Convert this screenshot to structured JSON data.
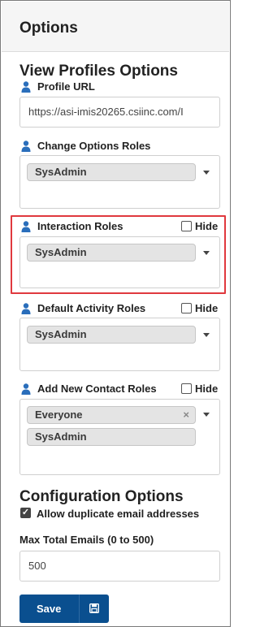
{
  "panel": {
    "title": "Options"
  },
  "view_profiles": {
    "title": "View Profiles Options",
    "profile_url": {
      "label": "Profile URL",
      "value": "https://asi-imis20265.csiinc.com/I"
    },
    "change_options_roles": {
      "label": "Change Options Roles",
      "tags": [
        "SysAdmin"
      ]
    },
    "interaction_roles": {
      "label": "Interaction Roles",
      "hide_label": "Hide",
      "hide_checked": false,
      "tags": [
        "SysAdmin"
      ]
    },
    "default_activity_roles": {
      "label": "Default Activity Roles",
      "hide_label": "Hide",
      "hide_checked": false,
      "tags": [
        "SysAdmin"
      ]
    },
    "add_new_contact_roles": {
      "label": "Add New Contact Roles",
      "hide_label": "Hide",
      "hide_checked": false,
      "tags": [
        "Everyone",
        "SysAdmin"
      ],
      "remove_glyph": "×"
    }
  },
  "configuration": {
    "title": "Configuration Options",
    "allow_duplicate": {
      "label": "Allow duplicate email addresses",
      "checked": true
    },
    "max_total_emails": {
      "label": "Max Total Emails (0 to 500)",
      "value": "500"
    }
  },
  "actions": {
    "save_label": "Save",
    "save_icon": "floppy-disk-icon"
  },
  "colors": {
    "accent_blue": "#0a4f8f",
    "highlight_red": "#e0393e",
    "tag_bg": "#e4e4e4",
    "header_bg": "#f5f5f5"
  }
}
